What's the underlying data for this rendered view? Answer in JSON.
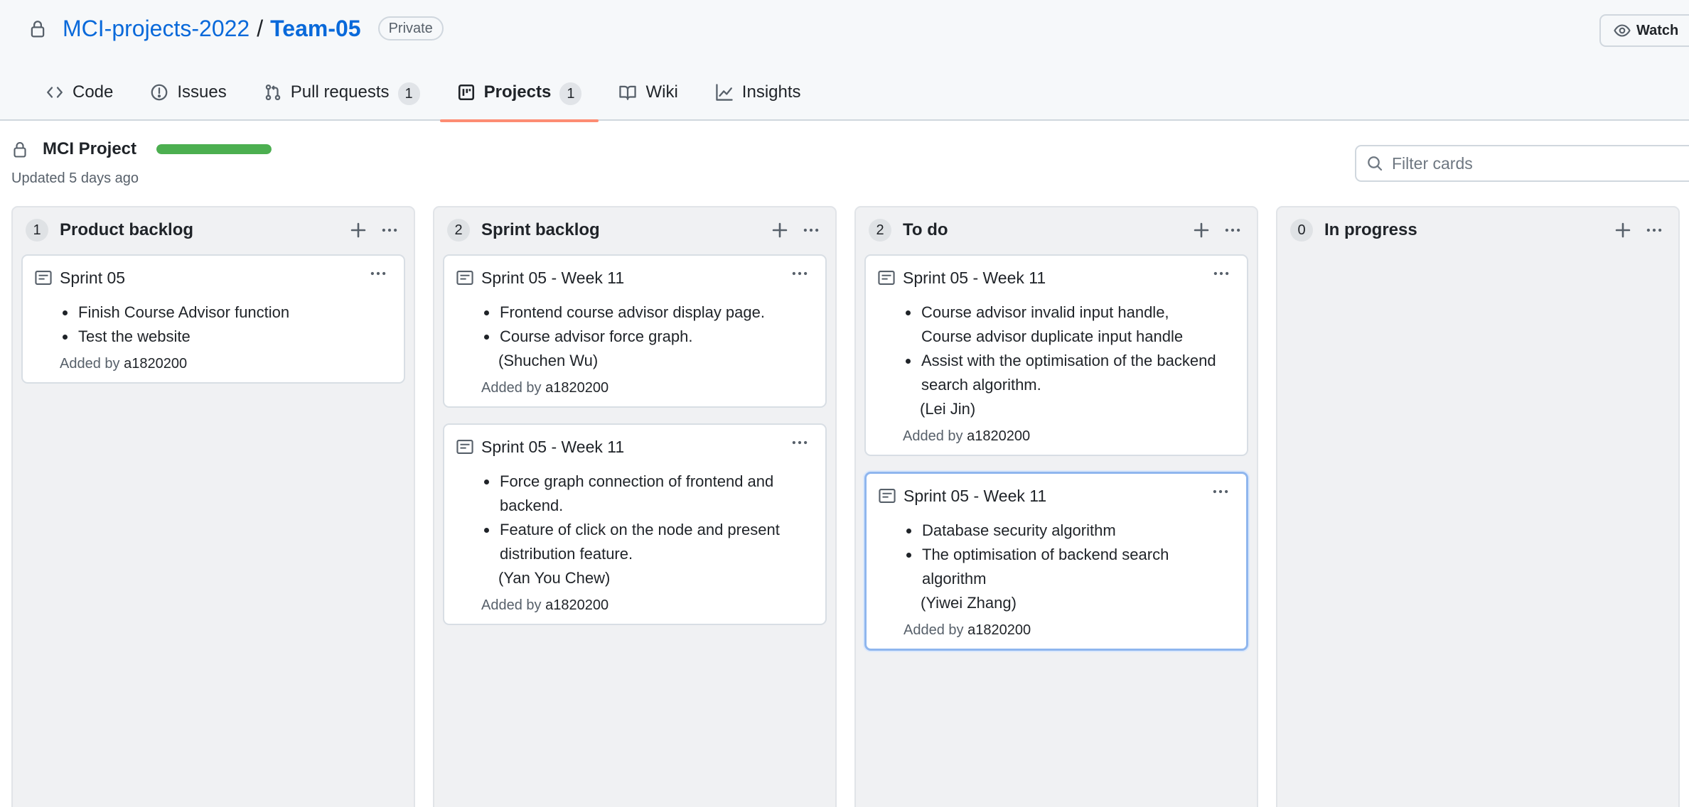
{
  "repo": {
    "owner": "MCI-projects-2022",
    "separator": "/",
    "name": "Team-05",
    "visibility": "Private",
    "watch_label": "Watch"
  },
  "tabs": [
    {
      "label": "Code",
      "icon": "code-icon",
      "counter": null
    },
    {
      "label": "Issues",
      "icon": "issue-icon",
      "counter": null
    },
    {
      "label": "Pull requests",
      "icon": "pull-request-icon",
      "counter": "1"
    },
    {
      "label": "Projects",
      "icon": "project-icon",
      "counter": "1",
      "selected": true
    },
    {
      "label": "Wiki",
      "icon": "book-icon",
      "counter": null
    },
    {
      "label": "Insights",
      "icon": "graph-icon",
      "counter": null
    }
  ],
  "project": {
    "name": "MCI Project",
    "progress_percent": 100,
    "updated": "Updated 5 days ago",
    "filter_placeholder": "Filter cards"
  },
  "colors": {
    "accent_link": "#0969da",
    "tab_underline": "#fd8c73",
    "progress": "#4caf50"
  },
  "columns": [
    {
      "count": "1",
      "title": "Product backlog",
      "cards": [
        {
          "title": "Sprint 05",
          "items": [
            "Finish Course Advisor function",
            "Test the website"
          ],
          "note": "",
          "added_prefix": "Added by",
          "added_by": "a1820200"
        }
      ]
    },
    {
      "count": "2",
      "title": "Sprint backlog",
      "cards": [
        {
          "title": "Sprint 05 - Week 11",
          "items": [
            "Frontend course advisor display page.",
            "Course advisor force graph."
          ],
          "note": "(Shuchen Wu)",
          "added_prefix": "Added by",
          "added_by": "a1820200"
        },
        {
          "title": "Sprint 05 - Week 11",
          "items": [
            "Force graph connection of frontend and backend.",
            "Feature of click on the node and present distribution feature."
          ],
          "note": "(Yan You Chew)",
          "added_prefix": "Added by",
          "added_by": "a1820200"
        }
      ]
    },
    {
      "count": "2",
      "title": "To do",
      "cards": [
        {
          "title": "Sprint 05 - Week 11",
          "items": [
            "Course advisor invalid input handle, Course advisor duplicate input handle",
            "Assist with the optimisation of the backend search algorithm."
          ],
          "note": "(Lei Jin)",
          "added_prefix": "Added by",
          "added_by": "a1820200"
        },
        {
          "title": "Sprint 05 - Week 11",
          "items": [
            "Database security algorithm",
            "The optimisation of backend search algorithm"
          ],
          "note": "(Yiwei Zhang)",
          "added_prefix": "Added by",
          "added_by": "a1820200"
        }
      ]
    },
    {
      "count": "0",
      "title": "In progress",
      "cards": []
    }
  ]
}
